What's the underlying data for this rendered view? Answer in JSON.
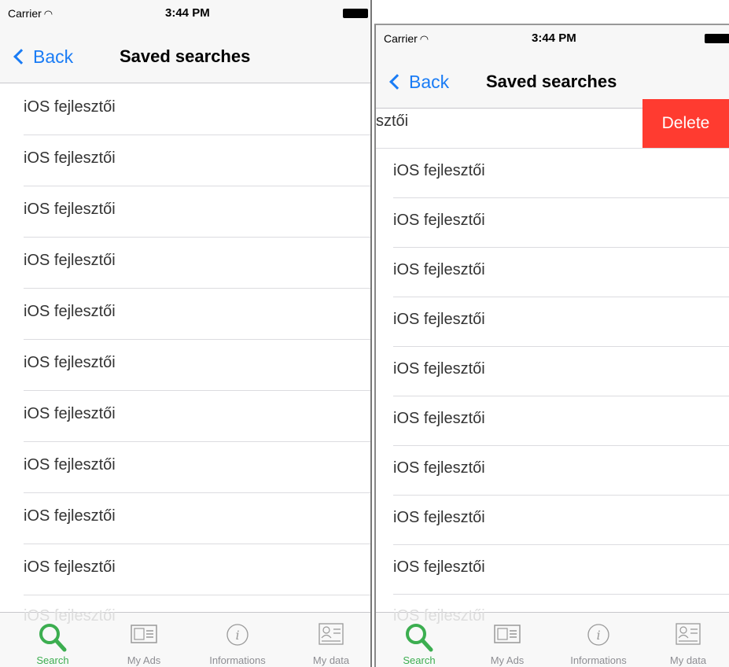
{
  "statusbar": {
    "carrier": "Carrier",
    "time": "3:44 PM"
  },
  "navbar": {
    "back_label": "Back",
    "title": "Saved searches"
  },
  "rows": [
    "iOS fejlesztői",
    "iOS fejlesztői",
    "iOS fejlesztői",
    "iOS fejlesztői",
    "iOS fejlesztői",
    "iOS fejlesztői",
    "iOS fejlesztői",
    "iOS fejlesztői",
    "iOS fejlesztői",
    "iOS fejlesztői"
  ],
  "swiped_row": {
    "visible_label": "sztői",
    "delete_label": "Delete"
  },
  "right_rows": [
    "iOS fejlesztői",
    "iOS fejlesztői",
    "iOS fejlesztői",
    "iOS fejlesztői",
    "iOS fejlesztői",
    "iOS fejlesztői",
    "iOS fejlesztői",
    "iOS fejlesztői",
    "iOS fejlesztői"
  ],
  "ghost_row": "iOS fejlesztői",
  "tabbar": {
    "tabs": [
      {
        "label": "Search",
        "icon": "magnifier-icon",
        "active": true
      },
      {
        "label": "My Ads",
        "icon": "ads-icon",
        "active": false
      },
      {
        "label": "Informations",
        "icon": "info-icon",
        "active": false
      },
      {
        "label": "My data",
        "icon": "id-card-icon",
        "active": false
      }
    ]
  },
  "colors": {
    "accent": "#1a7cf5",
    "delete": "#ff3b30",
    "tab_active": "#3cae50",
    "tab_inactive": "#8e8e93"
  }
}
